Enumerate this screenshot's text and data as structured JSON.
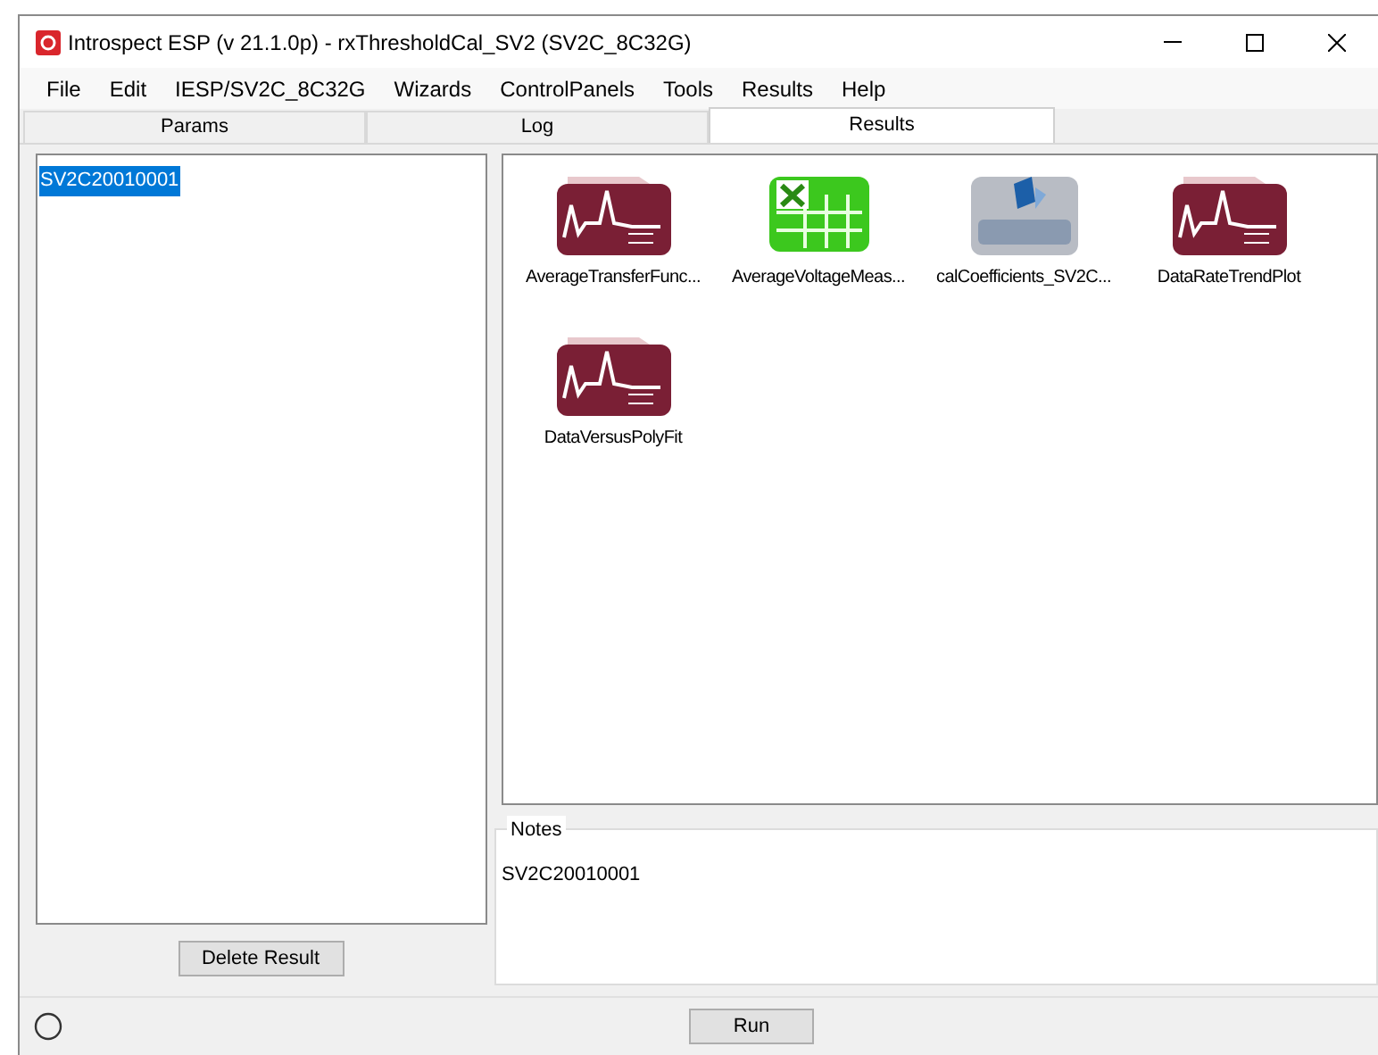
{
  "window": {
    "title": "Introspect ESP (v 21.1.0p) - rxThresholdCal_SV2 (SV2C_8C32G)"
  },
  "menu": [
    "File",
    "Edit",
    "IESP/SV2C_8C32G",
    "Wizards",
    "ControlPanels",
    "Tools",
    "Results",
    "Help"
  ],
  "tabs": [
    {
      "label": "Params",
      "selected": false
    },
    {
      "label": "Log",
      "selected": false
    },
    {
      "label": "Results",
      "selected": true
    }
  ],
  "results_list": {
    "items": [
      {
        "label": "SV2C20010001",
        "selected": true
      }
    ],
    "delete_button": "Delete Result"
  },
  "result_files": [
    {
      "label": "AverageTransferFunc...",
      "kind": "plot"
    },
    {
      "label": "AverageVoltageMeas...",
      "kind": "excel"
    },
    {
      "label": "calCoefficients_SV2C...",
      "kind": "report"
    },
    {
      "label": "DataRateTrendPlot",
      "kind": "plot"
    },
    {
      "label": "DataVersusPolyFit",
      "kind": "plot"
    }
  ],
  "notes": {
    "title": "Notes",
    "text": "SV2C20010001"
  },
  "run_button": "Run"
}
